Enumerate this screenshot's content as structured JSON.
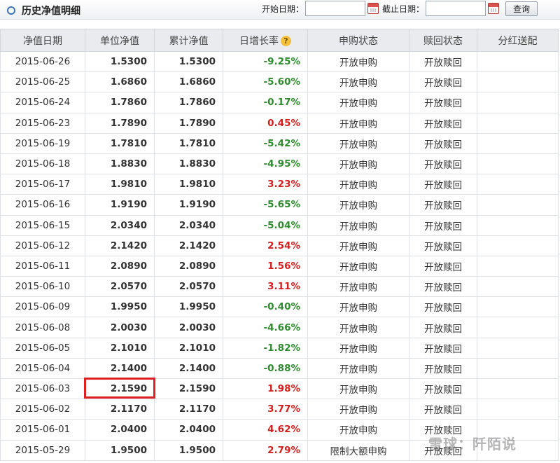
{
  "header": {
    "title": "历史净值明细",
    "start_label": "开始日期：",
    "end_label": "截止日期：",
    "start_value": "",
    "end_value": "",
    "query_label": "查询"
  },
  "table": {
    "columns": [
      "净值日期",
      "单位净值",
      "累计净值",
      "日增长率",
      "申购状态",
      "赎回状态",
      "分红送配"
    ],
    "rows": [
      {
        "date": "2015-06-26",
        "nav": "1.5300",
        "acc": "1.5300",
        "rate": "-9.25%",
        "buy": "开放申购",
        "sell": "开放赎回",
        "div": ""
      },
      {
        "date": "2015-06-25",
        "nav": "1.6860",
        "acc": "1.6860",
        "rate": "-5.60%",
        "buy": "开放申购",
        "sell": "开放赎回",
        "div": ""
      },
      {
        "date": "2015-06-24",
        "nav": "1.7860",
        "acc": "1.7860",
        "rate": "-0.17%",
        "buy": "开放申购",
        "sell": "开放赎回",
        "div": ""
      },
      {
        "date": "2015-06-23",
        "nav": "1.7890",
        "acc": "1.7890",
        "rate": "0.45%",
        "buy": "开放申购",
        "sell": "开放赎回",
        "div": ""
      },
      {
        "date": "2015-06-19",
        "nav": "1.7810",
        "acc": "1.7810",
        "rate": "-5.42%",
        "buy": "开放申购",
        "sell": "开放赎回",
        "div": ""
      },
      {
        "date": "2015-06-18",
        "nav": "1.8830",
        "acc": "1.8830",
        "rate": "-4.95%",
        "buy": "开放申购",
        "sell": "开放赎回",
        "div": ""
      },
      {
        "date": "2015-06-17",
        "nav": "1.9810",
        "acc": "1.9810",
        "rate": "3.23%",
        "buy": "开放申购",
        "sell": "开放赎回",
        "div": ""
      },
      {
        "date": "2015-06-16",
        "nav": "1.9190",
        "acc": "1.9190",
        "rate": "-5.65%",
        "buy": "开放申购",
        "sell": "开放赎回",
        "div": ""
      },
      {
        "date": "2015-06-15",
        "nav": "2.0340",
        "acc": "2.0340",
        "rate": "-5.04%",
        "buy": "开放申购",
        "sell": "开放赎回",
        "div": ""
      },
      {
        "date": "2015-06-12",
        "nav": "2.1420",
        "acc": "2.1420",
        "rate": "2.54%",
        "buy": "开放申购",
        "sell": "开放赎回",
        "div": ""
      },
      {
        "date": "2015-06-11",
        "nav": "2.0890",
        "acc": "2.0890",
        "rate": "1.56%",
        "buy": "开放申购",
        "sell": "开放赎回",
        "div": ""
      },
      {
        "date": "2015-06-10",
        "nav": "2.0570",
        "acc": "2.0570",
        "rate": "3.11%",
        "buy": "开放申购",
        "sell": "开放赎回",
        "div": ""
      },
      {
        "date": "2015-06-09",
        "nav": "1.9950",
        "acc": "1.9950",
        "rate": "-0.40%",
        "buy": "开放申购",
        "sell": "开放赎回",
        "div": ""
      },
      {
        "date": "2015-06-08",
        "nav": "2.0030",
        "acc": "2.0030",
        "rate": "-4.66%",
        "buy": "开放申购",
        "sell": "开放赎回",
        "div": ""
      },
      {
        "date": "2015-06-05",
        "nav": "2.1010",
        "acc": "2.1010",
        "rate": "-1.82%",
        "buy": "开放申购",
        "sell": "开放赎回",
        "div": ""
      },
      {
        "date": "2015-06-04",
        "nav": "2.1400",
        "acc": "2.1400",
        "rate": "-0.88%",
        "buy": "开放申购",
        "sell": "开放赎回",
        "div": ""
      },
      {
        "date": "2015-06-03",
        "nav": "2.1590",
        "acc": "2.1590",
        "rate": "1.98%",
        "buy": "开放申购",
        "sell": "开放赎回",
        "div": ""
      },
      {
        "date": "2015-06-02",
        "nav": "2.1170",
        "acc": "2.1170",
        "rate": "3.77%",
        "buy": "开放申购",
        "sell": "开放赎回",
        "div": ""
      },
      {
        "date": "2015-06-01",
        "nav": "2.0400",
        "acc": "2.0400",
        "rate": "4.62%",
        "buy": "开放申购",
        "sell": "开放赎回",
        "div": ""
      },
      {
        "date": "2015-05-29",
        "nav": "1.9500",
        "acc": "1.9500",
        "rate": "2.79%",
        "buy": "限制大额申购",
        "sell": "开放赎回",
        "div": ""
      }
    ]
  },
  "watermark": "雪球：阡陌说",
  "colors": {
    "negative": "#2e8b2e",
    "positive": "#d41f1f",
    "highlight_border": "#e02020",
    "accent": "#3b73b9"
  }
}
